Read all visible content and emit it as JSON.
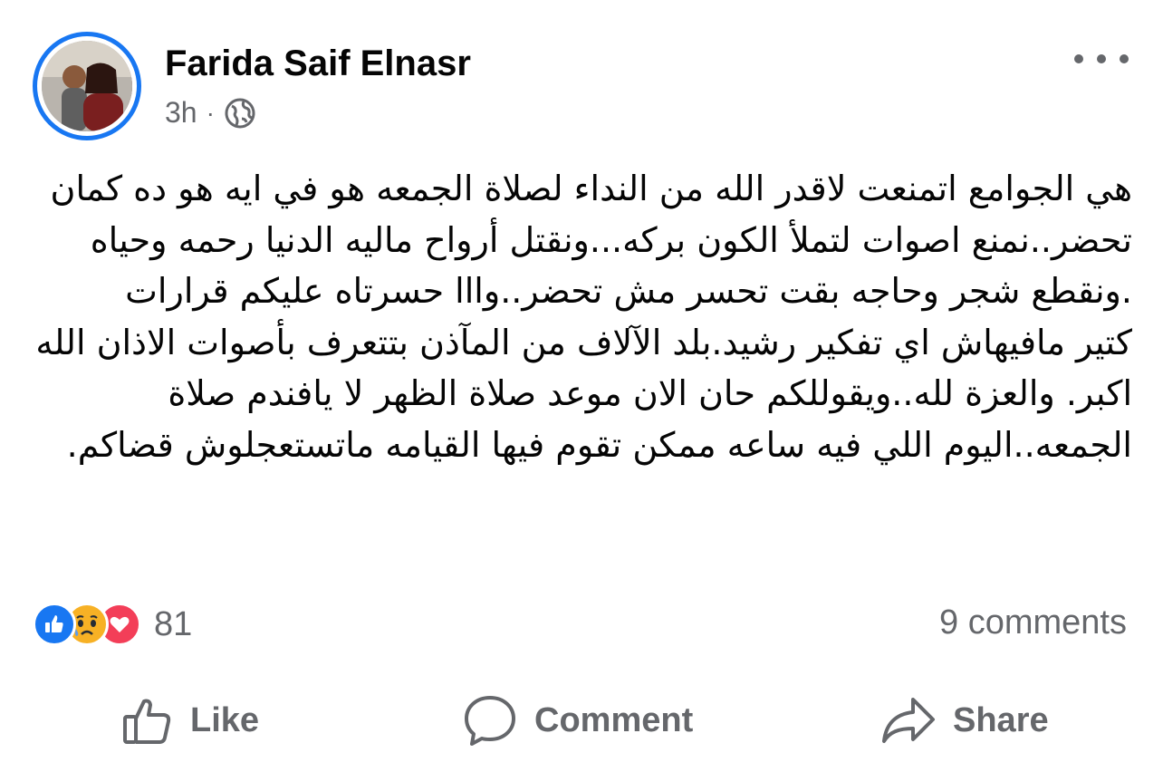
{
  "author": {
    "name": "Farida Saif Elnasr",
    "time": "3h",
    "separator": "·",
    "privacy_icon": "globe-icon"
  },
  "post": {
    "text": "هي الجوامع اتمنعت لاقدر الله من النداء لصلاة الجمعه هو في ايه هو ده كمان تحضر..نمنع اصوات لتملأ الكون بركه...ونقتل أرواح ماليه الدنيا رحمه وحياه .ونقطع شجر وحاجه بقت تحسر مش تحضر..وااا حسرتاه عليكم قرارات\nكتير مافيهاش اي تفكير رشيد.بلد الآلاف من المآذن بتتعرف بأصوات الاذان الله اكبر. والعزة لله..ويقوللكم حان الان موعد صلاة الظهر لا يافندم صلاة الجمعه..اليوم اللي فيه ساعه ممكن تقوم فيها القيامه ماتستعجلوش قضاكم."
  },
  "reactions": {
    "icons": [
      "like-reaction-icon",
      "sad-reaction-icon",
      "love-reaction-icon"
    ],
    "count": "81"
  },
  "comments": {
    "label": "9 comments"
  },
  "actions": {
    "like": "Like",
    "comment": "Comment",
    "share": "Share"
  },
  "colors": {
    "accent": "#1877f2",
    "secondary_text": "#65676b",
    "sad": "#f7b125",
    "love": "#f33e58"
  }
}
